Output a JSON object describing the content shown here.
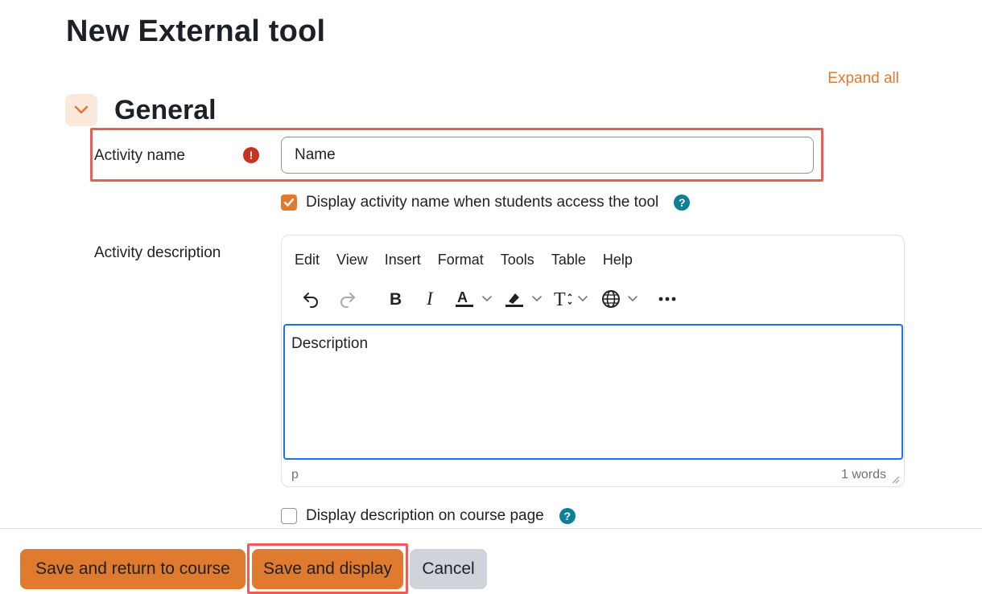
{
  "page": {
    "title": "New External tool",
    "expand_all": "Expand all"
  },
  "section": {
    "title": "General",
    "collapse_icon": "chevron-down-icon"
  },
  "activity_name": {
    "label": "Activity name",
    "value": "Name",
    "required_icon": "exclamation-circle-icon"
  },
  "display_name_checkbox": {
    "label": "Display activity name when students access the tool",
    "checked": true
  },
  "activity_description": {
    "label": "Activity description"
  },
  "editor": {
    "menu": [
      "Edit",
      "View",
      "Insert",
      "Format",
      "Tools",
      "Table",
      "Help"
    ],
    "toolbar": [
      "undo-icon",
      "redo-icon",
      "bold-icon",
      "italic-icon",
      "text-color-icon",
      "highlight-color-icon",
      "font-size-icon",
      "language-icon",
      "more-icon"
    ],
    "content": "Description",
    "status_path": "p",
    "word_count": "1 words"
  },
  "display_description_checkbox": {
    "label": "Display description on course page",
    "checked": false
  },
  "footer": {
    "save_return": "Save and return to course",
    "save_display": "Save and display",
    "cancel": "Cancel"
  },
  "colors": {
    "accent": "#e07a2e",
    "highlight_border": "#ef5a5a",
    "help": "#0f7f94",
    "required": "#ca3120",
    "editor_focus": "#1a73e8"
  }
}
